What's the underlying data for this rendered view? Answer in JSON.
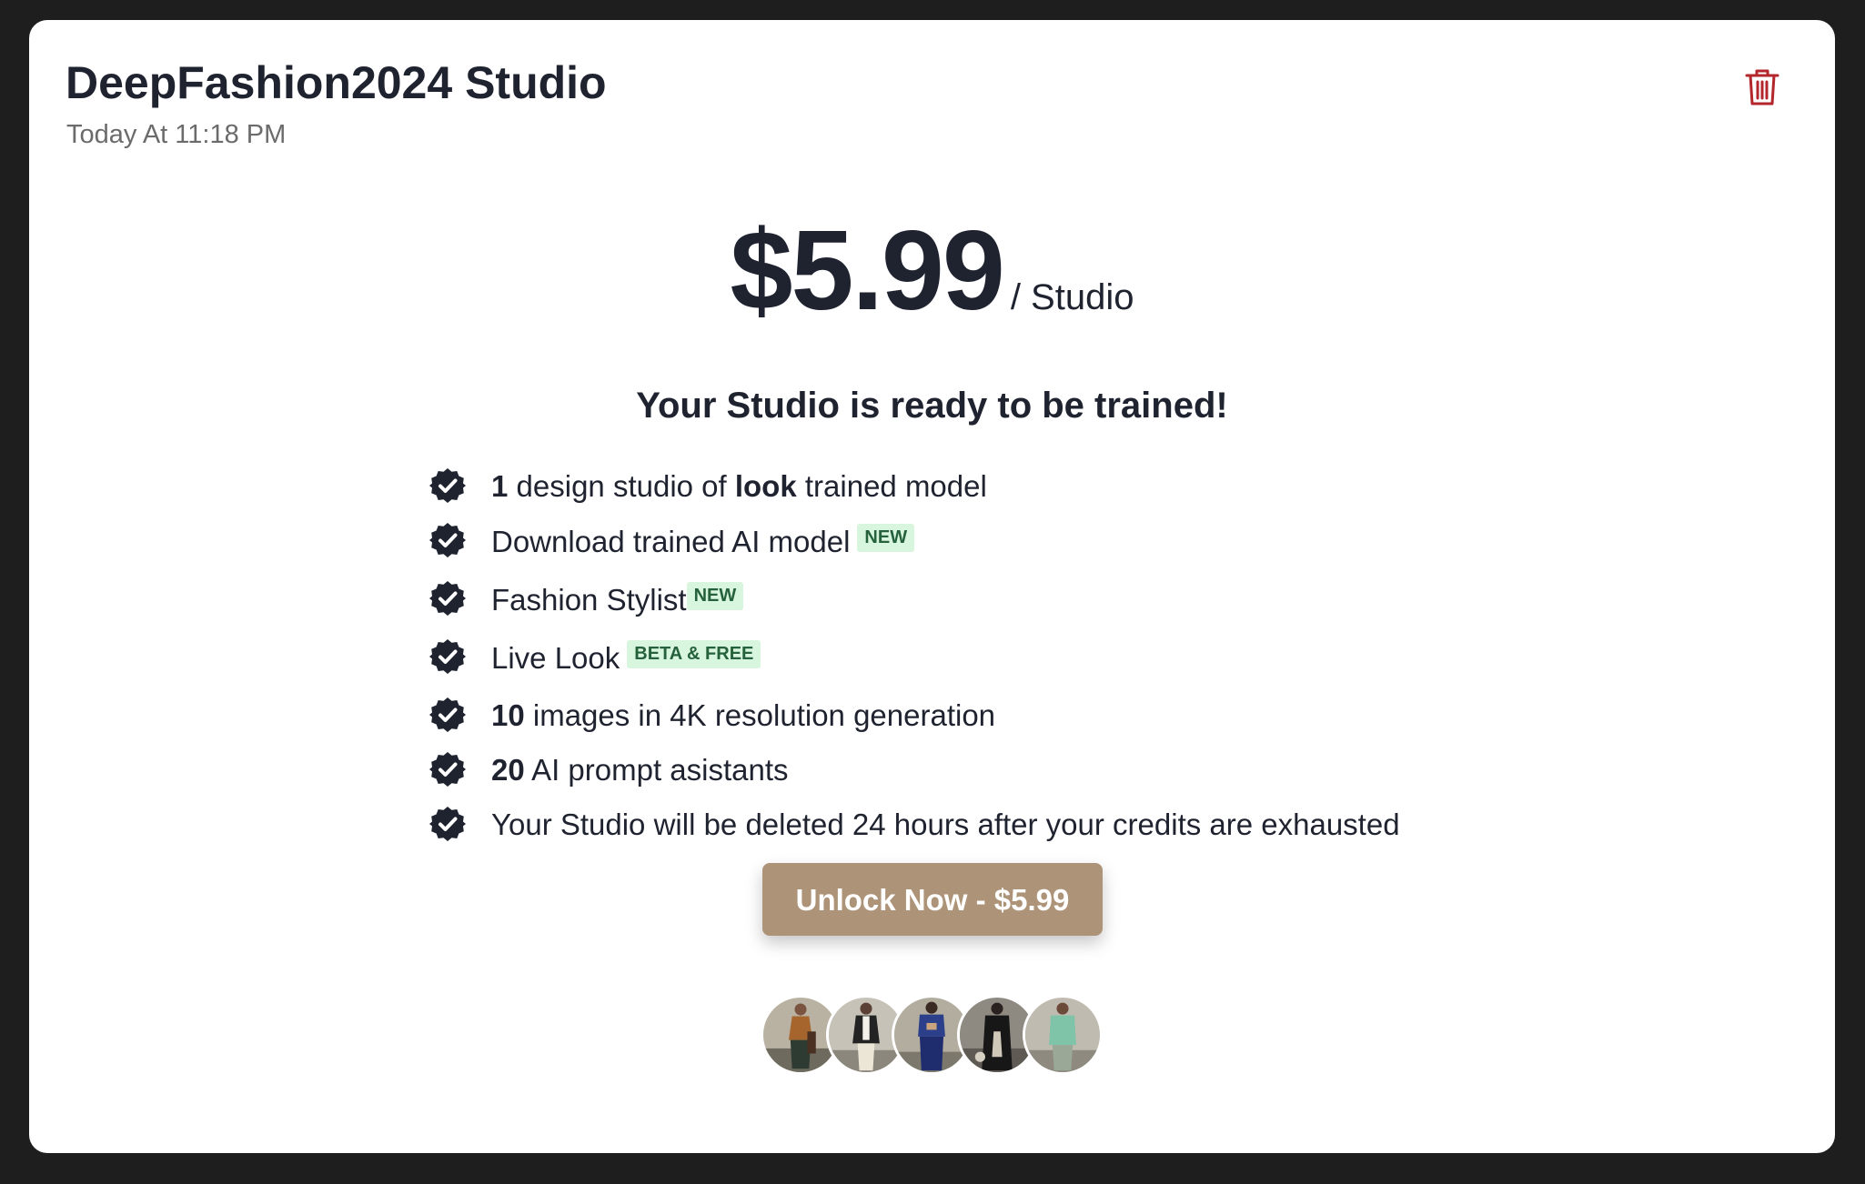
{
  "header": {
    "title": "DeepFashion2024 Studio",
    "date": "Today At 11:18 PM"
  },
  "pricing": {
    "price": "$5.99",
    "unit": "/ Studio"
  },
  "ready_heading": "Your Studio is ready to be trained!",
  "features": [
    {
      "bold1": "1",
      "text1": " design studio of ",
      "bold2": "look",
      "text2": " trained model"
    },
    {
      "text": "Download trained AI model",
      "badge": "NEW"
    },
    {
      "text": "Fashion Stylist",
      "badge": "NEW"
    },
    {
      "text": "Live Look",
      "badge": "BETA & FREE"
    },
    {
      "bold": "10",
      "text": " images in 4K resolution generation"
    },
    {
      "bold": "20",
      "text": " AI prompt asistants"
    },
    {
      "text": "Your Studio will be deleted 24 hours after your credits are exhausted"
    }
  ],
  "cta": {
    "label": "Unlock Now - $5.99"
  },
  "icons": {
    "delete": "trash-icon",
    "check": "check-badge-icon"
  },
  "colors": {
    "accent": "#ad9479",
    "delete": "#b3262b",
    "badge_bg": "#d8f5de",
    "badge_text": "#25613a",
    "text": "#1f2330"
  }
}
